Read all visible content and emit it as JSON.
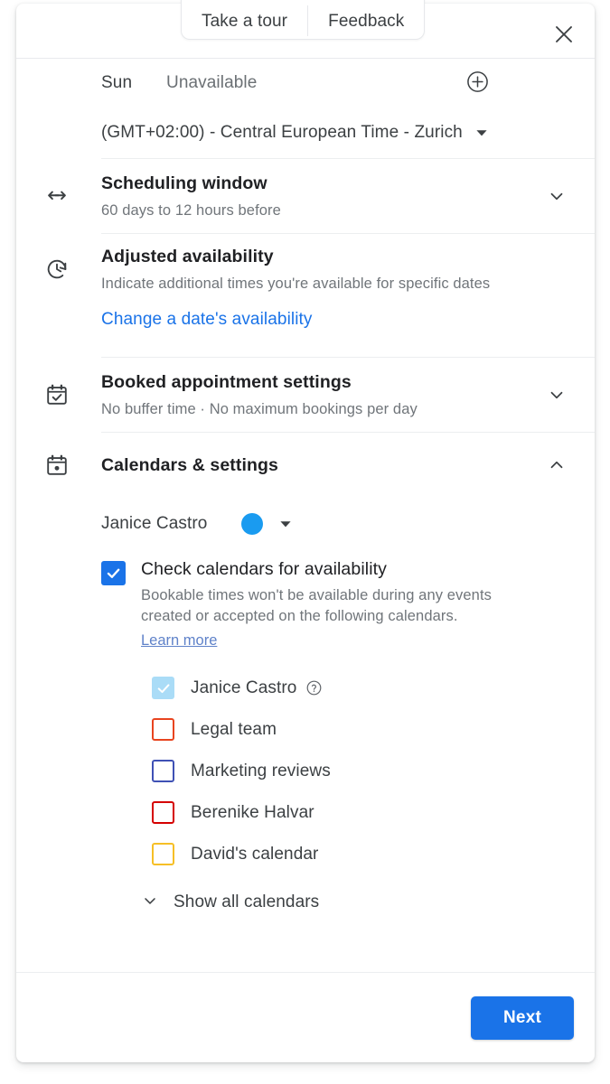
{
  "header": {
    "take_tour_label": "Take a tour",
    "feedback_label": "Feedback",
    "close_icon": "close-icon"
  },
  "availability": {
    "day_label": "Sun",
    "day_state": "Unavailable",
    "add_icon": "plus-circle-icon",
    "timezone": "(GMT+02:00) - Central European Time - Zurich",
    "timezone_caret_icon": "caret-down-icon"
  },
  "sections": {
    "scheduling_window": {
      "icon": "bidirectional-arrow-icon",
      "title": "Scheduling window",
      "subtitle": "60 days to 12 hours before",
      "chevron_icon": "chevron-down-icon"
    },
    "adjusted_availability": {
      "icon": "clock-update-icon",
      "title": "Adjusted availability",
      "subtitle": "Indicate additional times you're available for specific dates",
      "link_label": "Change a date's availability"
    },
    "booked_appointment": {
      "icon": "calendar-check-icon",
      "title": "Booked appointment settings",
      "subtitle": "No buffer time · No maximum bookings per day",
      "chevron_icon": "chevron-down-icon"
    },
    "calendars_settings": {
      "icon": "calendar-event-icon",
      "title": "Calendars & settings",
      "chevron_icon": "chevron-up-icon"
    }
  },
  "calendars_panel": {
    "owner_name": "Janice Castro",
    "owner_color": "#1a9bf0",
    "owner_caret_icon": "caret-down-icon",
    "check_availability": {
      "label": "Check calendars for availability",
      "checked": true,
      "description_line1": "Bookable times won't be available during any events",
      "description_line2": "created or accepted on the following calendars.",
      "learn_more_label": "Learn more"
    },
    "calendar_items": [
      {
        "name": "Janice Castro",
        "color": "#aadcf7",
        "checked": true,
        "disabled": true,
        "help_icon": "help-circle-icon"
      },
      {
        "name": "Legal team",
        "color": "#e8441f",
        "checked": false,
        "disabled": false,
        "help_icon": ""
      },
      {
        "name": "Marketing reviews",
        "color": "#3f51b5",
        "checked": false,
        "disabled": false,
        "help_icon": ""
      },
      {
        "name": "Berenike Halvar",
        "color": "#d50000",
        "checked": false,
        "disabled": false,
        "help_icon": ""
      },
      {
        "name": "David's calendar",
        "color": "#f6bf26",
        "checked": false,
        "disabled": false,
        "help_icon": ""
      }
    ],
    "show_all_label": "Show all calendars",
    "show_all_icon": "chevron-down-icon"
  },
  "footer": {
    "next_label": "Next"
  },
  "colors": {
    "accent": "#1a73e8",
    "link": "#1a73e8",
    "text_primary": "#202124",
    "text_secondary": "#70757a",
    "divider": "#eceef0"
  }
}
